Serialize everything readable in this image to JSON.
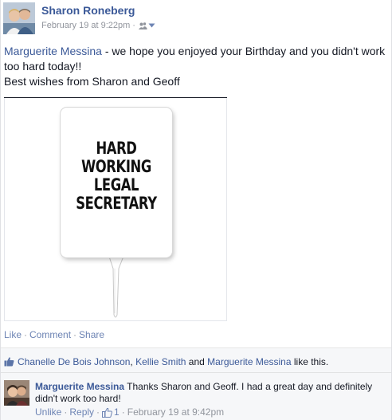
{
  "post": {
    "author": "Sharon Roneberg",
    "timestamp": "February 19 at 9:22pm",
    "meta_separator": "·",
    "audience_icon": "friends-icon",
    "message": {
      "mention": "Marguerite Messina",
      "text_after_mention": " - we hope you enjoyed your Birthday and you didn't work too hard today!!",
      "line2": "Best wishes from Sharon and Geoff"
    },
    "photo": {
      "sign_lines": [
        "HARD",
        "WORKING",
        "LEGAL",
        "SECRETARY"
      ]
    },
    "actions": {
      "like": "Like",
      "comment": "Comment",
      "share": "Share",
      "separator": "·"
    }
  },
  "likes": {
    "icon": "thumbs-up-icon",
    "names": [
      "Chanelle De Bois Johnson",
      "Kellie Smith",
      "Marguerite Messina"
    ],
    "joiner_comma": ", ",
    "joiner_and": " and ",
    "suffix": " like this."
  },
  "comment": {
    "author": "Marguerite Messina",
    "text": "Thanks Sharon and Geoff. I had a great day and definitely didn't work too hard!",
    "unlike": "Unlike",
    "reply": "Reply",
    "like_count": "1",
    "timestamp": "February 19 at 9:42pm",
    "separator": "·"
  },
  "colors": {
    "link": "#3b5998",
    "action_link": "#6d84b4",
    "muted": "#90949c",
    "text": "#141823",
    "panel": "#f6f7f9"
  }
}
